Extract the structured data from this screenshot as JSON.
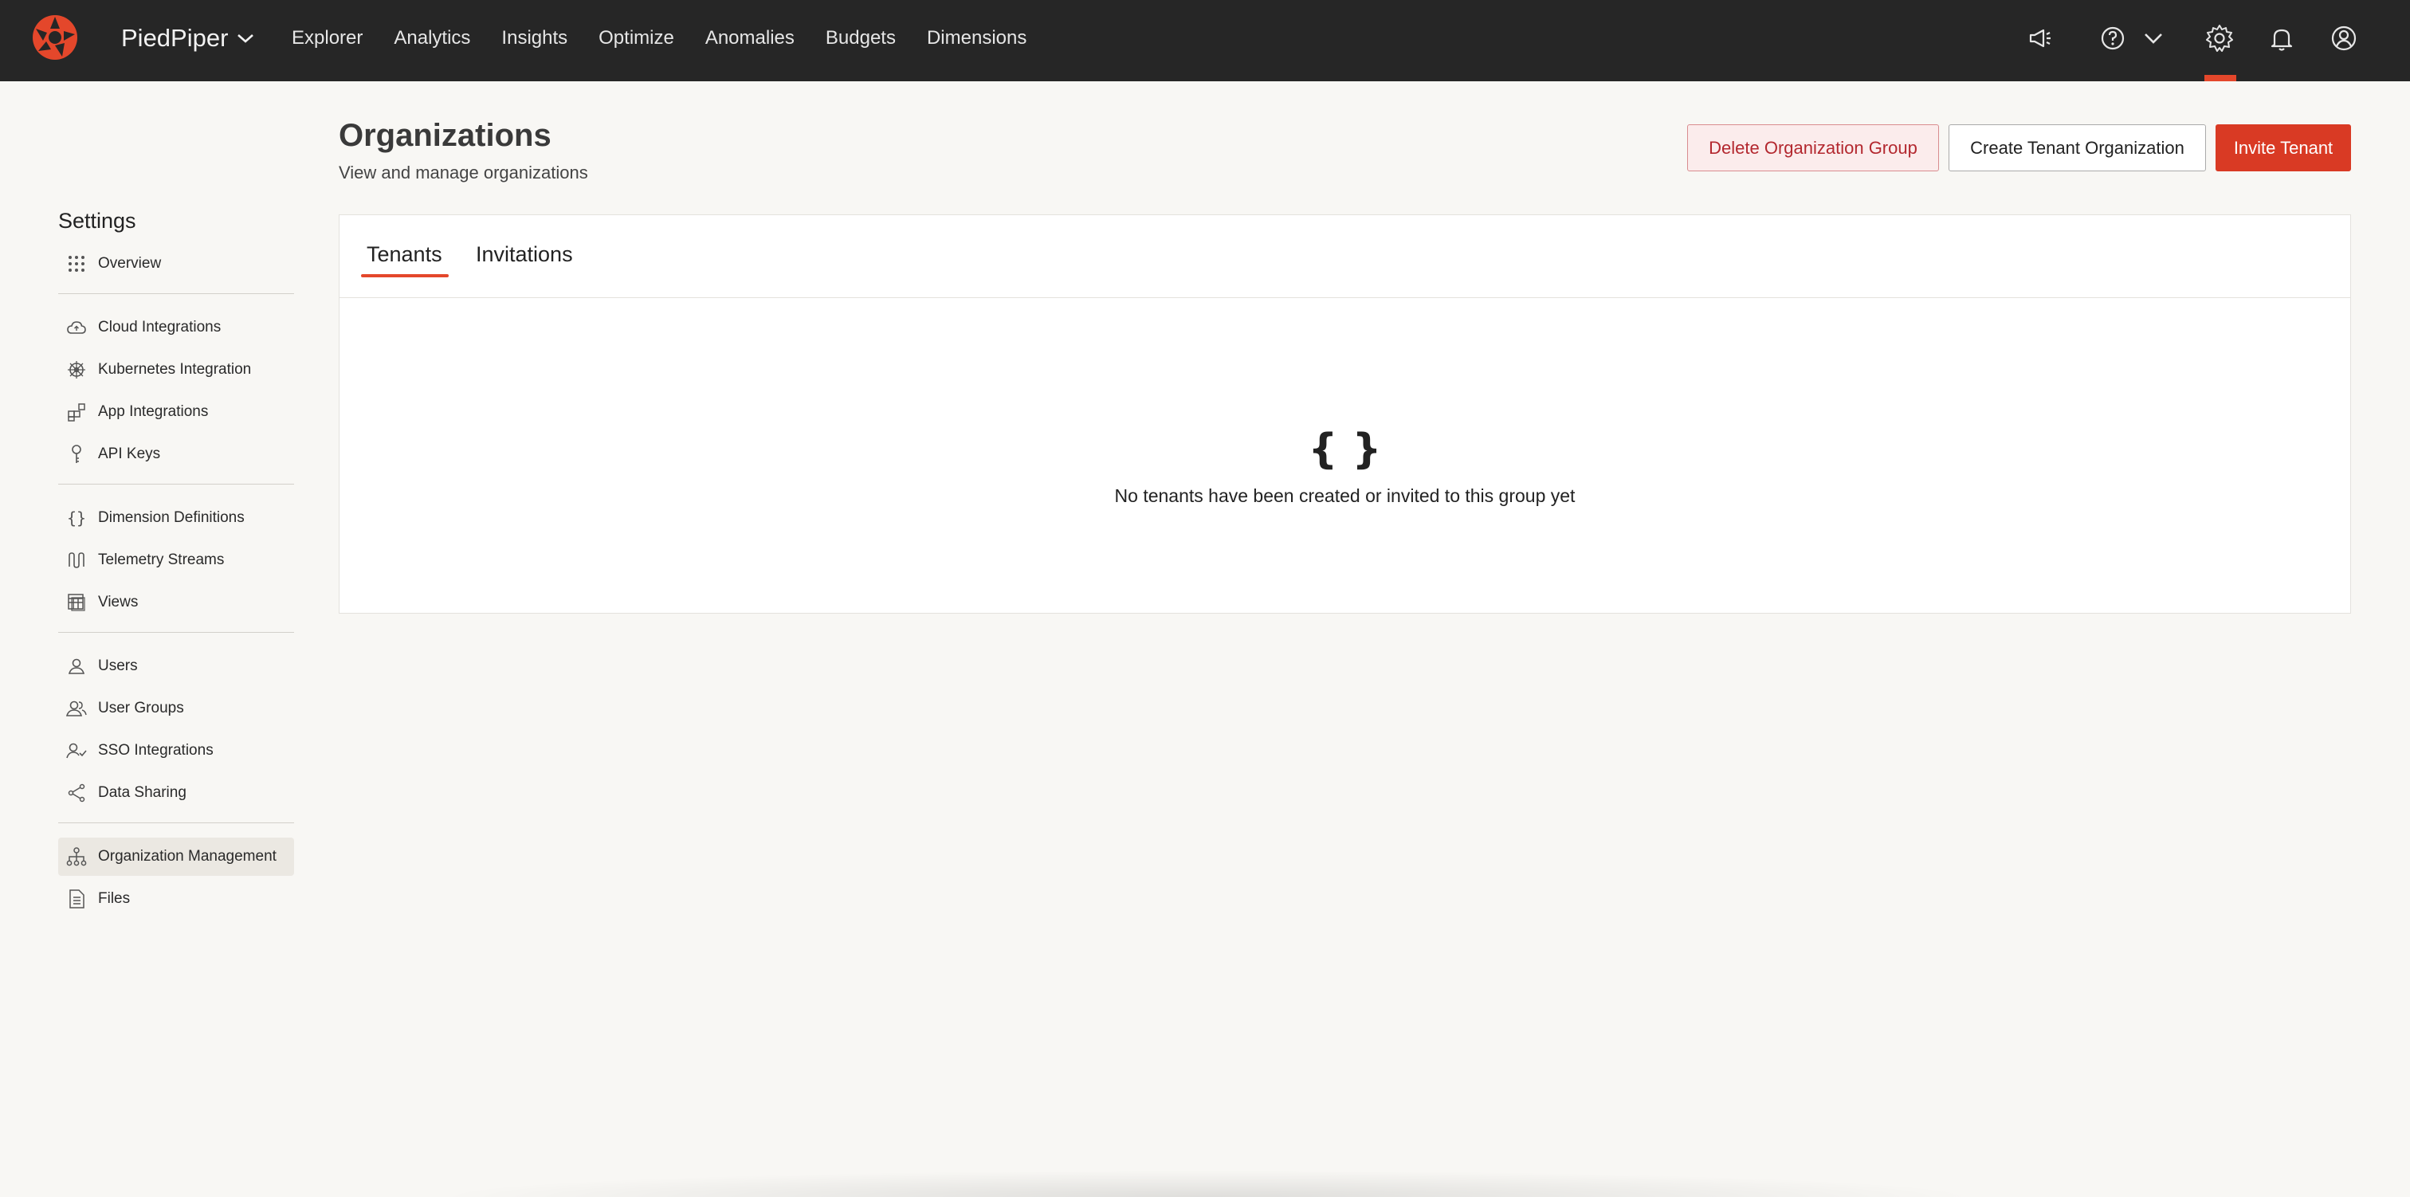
{
  "app": {
    "name": "PiedPiper",
    "brand_color": "#e4472b"
  },
  "nav": {
    "items": [
      "Explorer",
      "Analytics",
      "Insights",
      "Optimize",
      "Anomalies",
      "Budgets",
      "Dimensions"
    ],
    "right_icons": [
      "megaphone-icon",
      "help-icon",
      "chevron-down-icon",
      "gear-icon",
      "bell-icon",
      "user-icon"
    ],
    "active": "gear-icon"
  },
  "sidebar": {
    "title": "Settings",
    "groups": [
      [
        {
          "label": "Overview",
          "icon": "grid-icon"
        }
      ],
      [
        {
          "label": "Cloud Integrations",
          "icon": "cloud-icon"
        },
        {
          "label": "Kubernetes Integration",
          "icon": "kubernetes-icon"
        },
        {
          "label": "App Integrations",
          "icon": "apps-icon"
        },
        {
          "label": "API Keys",
          "icon": "key-icon"
        }
      ],
      [
        {
          "label": "Dimension Definitions",
          "icon": "braces-icon"
        },
        {
          "label": "Telemetry Streams",
          "icon": "stream-icon"
        },
        {
          "label": "Views",
          "icon": "table-icon"
        }
      ],
      [
        {
          "label": "Users",
          "icon": "user-icon"
        },
        {
          "label": "User Groups",
          "icon": "users-icon"
        },
        {
          "label": "SSO Integrations",
          "icon": "user-check-icon"
        },
        {
          "label": "Data Sharing",
          "icon": "share-icon"
        }
      ],
      [
        {
          "label": "Organization Management",
          "icon": "hierarchy-icon",
          "active": true
        },
        {
          "label": "Files",
          "icon": "file-icon"
        }
      ]
    ]
  },
  "header": {
    "title": "Organizations",
    "subtitle": "View and manage organizations",
    "buttons": {
      "delete": "Delete Organization Group",
      "create": "Create Tenant Organization",
      "invite": "Invite Tenant"
    }
  },
  "tabs": {
    "items": [
      "Tenants",
      "Invitations"
    ],
    "active": "Tenants"
  },
  "empty_state": {
    "icon": "{ }",
    "message": "No tenants have been created or invited to this group yet"
  }
}
